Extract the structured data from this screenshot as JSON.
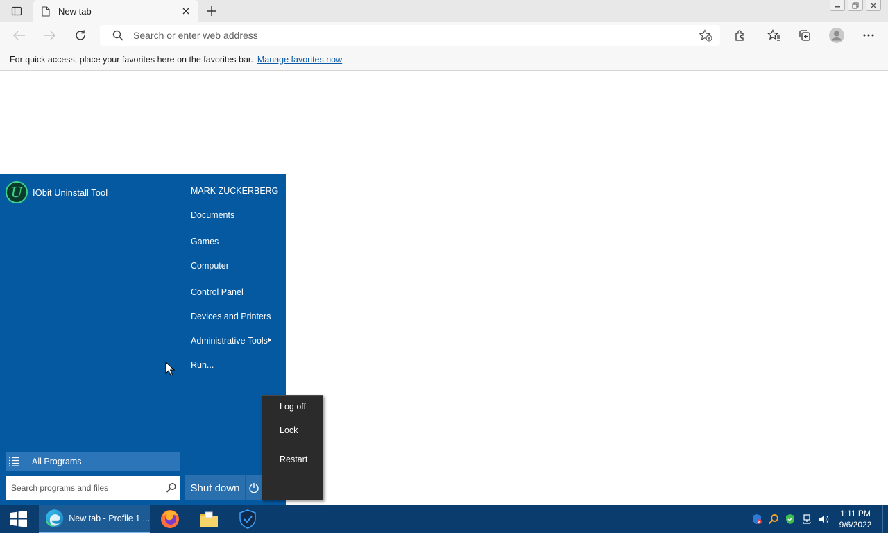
{
  "browser": {
    "tab": {
      "title": "New tab"
    },
    "address_bar": {
      "placeholder": "Search or enter web address"
    },
    "favorites_bar": {
      "message": "For quick access, place your favorites here on the favorites bar.",
      "link": "Manage favorites now"
    }
  },
  "start_menu": {
    "pinned_app": {
      "name": "IObit Uninstall Tool",
      "logo_letter": "U"
    },
    "right_column": [
      {
        "label": "MARK ZUCKERBERG"
      },
      {
        "label": "Documents"
      },
      {
        "label": "Games"
      },
      {
        "label": "Computer"
      },
      {
        "label": "Control Panel"
      },
      {
        "label": "Devices and Printers"
      },
      {
        "label": "Administrative Tools",
        "has_submenu": true
      },
      {
        "label": "Run..."
      }
    ],
    "all_programs": "All Programs",
    "search": {
      "placeholder": "Search programs and files"
    },
    "shutdown_label": "Shut down",
    "power_menu": [
      {
        "label": "Log off"
      },
      {
        "label": "Lock"
      },
      {
        "label": "Restart"
      }
    ]
  },
  "taskbar": {
    "active_window": "New tab - Profile 1 ...",
    "apps": [
      "edge-icon",
      "firefox-icon",
      "file-explorer-icon",
      "vpn-shield-icon"
    ],
    "tray_icons": [
      "security-icon",
      "search-tray-icon",
      "shield-check-icon",
      "network-icon",
      "volume-icon"
    ],
    "clock": {
      "time": "1:11 PM",
      "date": "9/6/2022"
    }
  },
  "colors": {
    "start_menu_bg": "#0459a1",
    "taskbar_bg": "#0b3c6e",
    "power_menu_bg": "#2b2b2b",
    "link": "#0c5aa6"
  }
}
